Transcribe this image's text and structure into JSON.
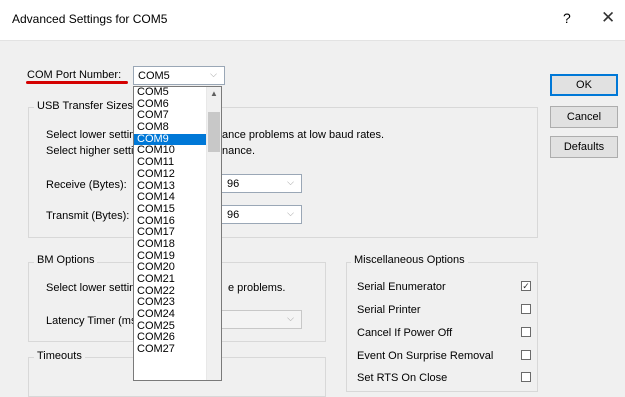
{
  "window": {
    "title": "Advanced Settings for COM5",
    "help_label": "?",
    "close_label": "✕"
  },
  "com_port": {
    "label": "COM Port Number:",
    "value": "COM5",
    "underline_color": "#d40000"
  },
  "usb": {
    "group_title": "USB Transfer Sizes",
    "line1_start": "Select lower settin",
    "line1_end": "ance problems at low baud rates.",
    "line2_start": "Select higher settin",
    "line2_end": "nance.",
    "receive_label": "Receive (Bytes):",
    "receive_value": "96",
    "transmit_label": "Transmit (Bytes):",
    "transmit_value": "96"
  },
  "bm": {
    "group_title": "BM Options",
    "line_start": "Select lower settin",
    "line_end": "e problems.",
    "latency_label": "Latency Timer (mse"
  },
  "timeouts": {
    "group_title": "Timeouts"
  },
  "misc": {
    "group_title": "Miscellaneous Options",
    "options": [
      {
        "label": "Serial Enumerator",
        "checked": true
      },
      {
        "label": "Serial Printer",
        "checked": false
      },
      {
        "label": "Cancel If Power Off",
        "checked": false
      },
      {
        "label": "Event On Surprise Removal",
        "checked": false
      },
      {
        "label": "Set RTS On Close",
        "checked": false
      }
    ]
  },
  "buttons": {
    "ok": "OK",
    "cancel": "Cancel",
    "defaults": "Defaults"
  },
  "dropdown": {
    "selected": "COM9",
    "items": [
      "COM5",
      "COM6",
      "COM7",
      "COM8",
      "COM9",
      "COM10",
      "COM11",
      "COM12",
      "COM13",
      "COM14",
      "COM15",
      "COM16",
      "COM17",
      "COM18",
      "COM19",
      "COM20",
      "COM21",
      "COM22",
      "COM23",
      "COM24",
      "COM25",
      "COM26",
      "COM27"
    ],
    "highlight_color": "#0078d7"
  },
  "icons": {
    "chevron": "chevron-down-icon",
    "scroll_up": "scroll-up-arrow-icon",
    "check": "check-icon"
  }
}
